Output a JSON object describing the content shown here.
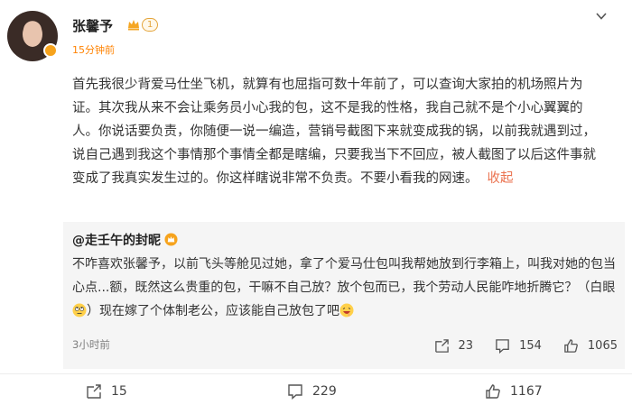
{
  "post": {
    "author": "张馨予",
    "level": "1",
    "time": "15分钟前",
    "text": "首先我很少背爱马仕坐飞机，就算有也屈指可数十年前了，可以查询大家拍的机场照片为证。其次我从来不会让乘务员小心我的包，这不是我的性格，我自己就不是个小心翼翼的人。你说话要负责，你随便一说一编造，营销号截图下来就变成我的锅，以前我就遇到过，说自己遇到我这个事情那个事情全都是瞎编，只要我当下不回应，被人截图了以后这件事就变成了我真实发生过的。你这样瞎说非常不负责。不要小看我的网速。",
    "collapse_label": "收起"
  },
  "comment": {
    "author": "@走壬午的封昵",
    "text_part1": "不咋喜欢张馨予，以前飞头等舱见过她，拿了个爱马仕包叫我帮她放到行李箱上，叫我对她的包当心点...额，既然这么贵重的包，干嘛不自己放？放个包而已，我个劳动人民能咋地折腾它？（白眼",
    "text_part2": "）现在嫁了个体制老公，应该能自己放包了吧",
    "time": "3小时前",
    "reposts": "23",
    "comments": "154",
    "likes": "1065"
  },
  "footer": {
    "reposts": "15",
    "comments": "229",
    "likes": "1167"
  },
  "icons": {
    "more": "chevron-down-icon",
    "vip": "vip-crown-icon",
    "repost": "repost-icon",
    "comment": "comment-icon",
    "like": "thumbs-up-icon"
  },
  "colors": {
    "accent_orange": "#ff8200",
    "collapse": "#eb7350",
    "comment_bg": "#f5f5f5"
  }
}
